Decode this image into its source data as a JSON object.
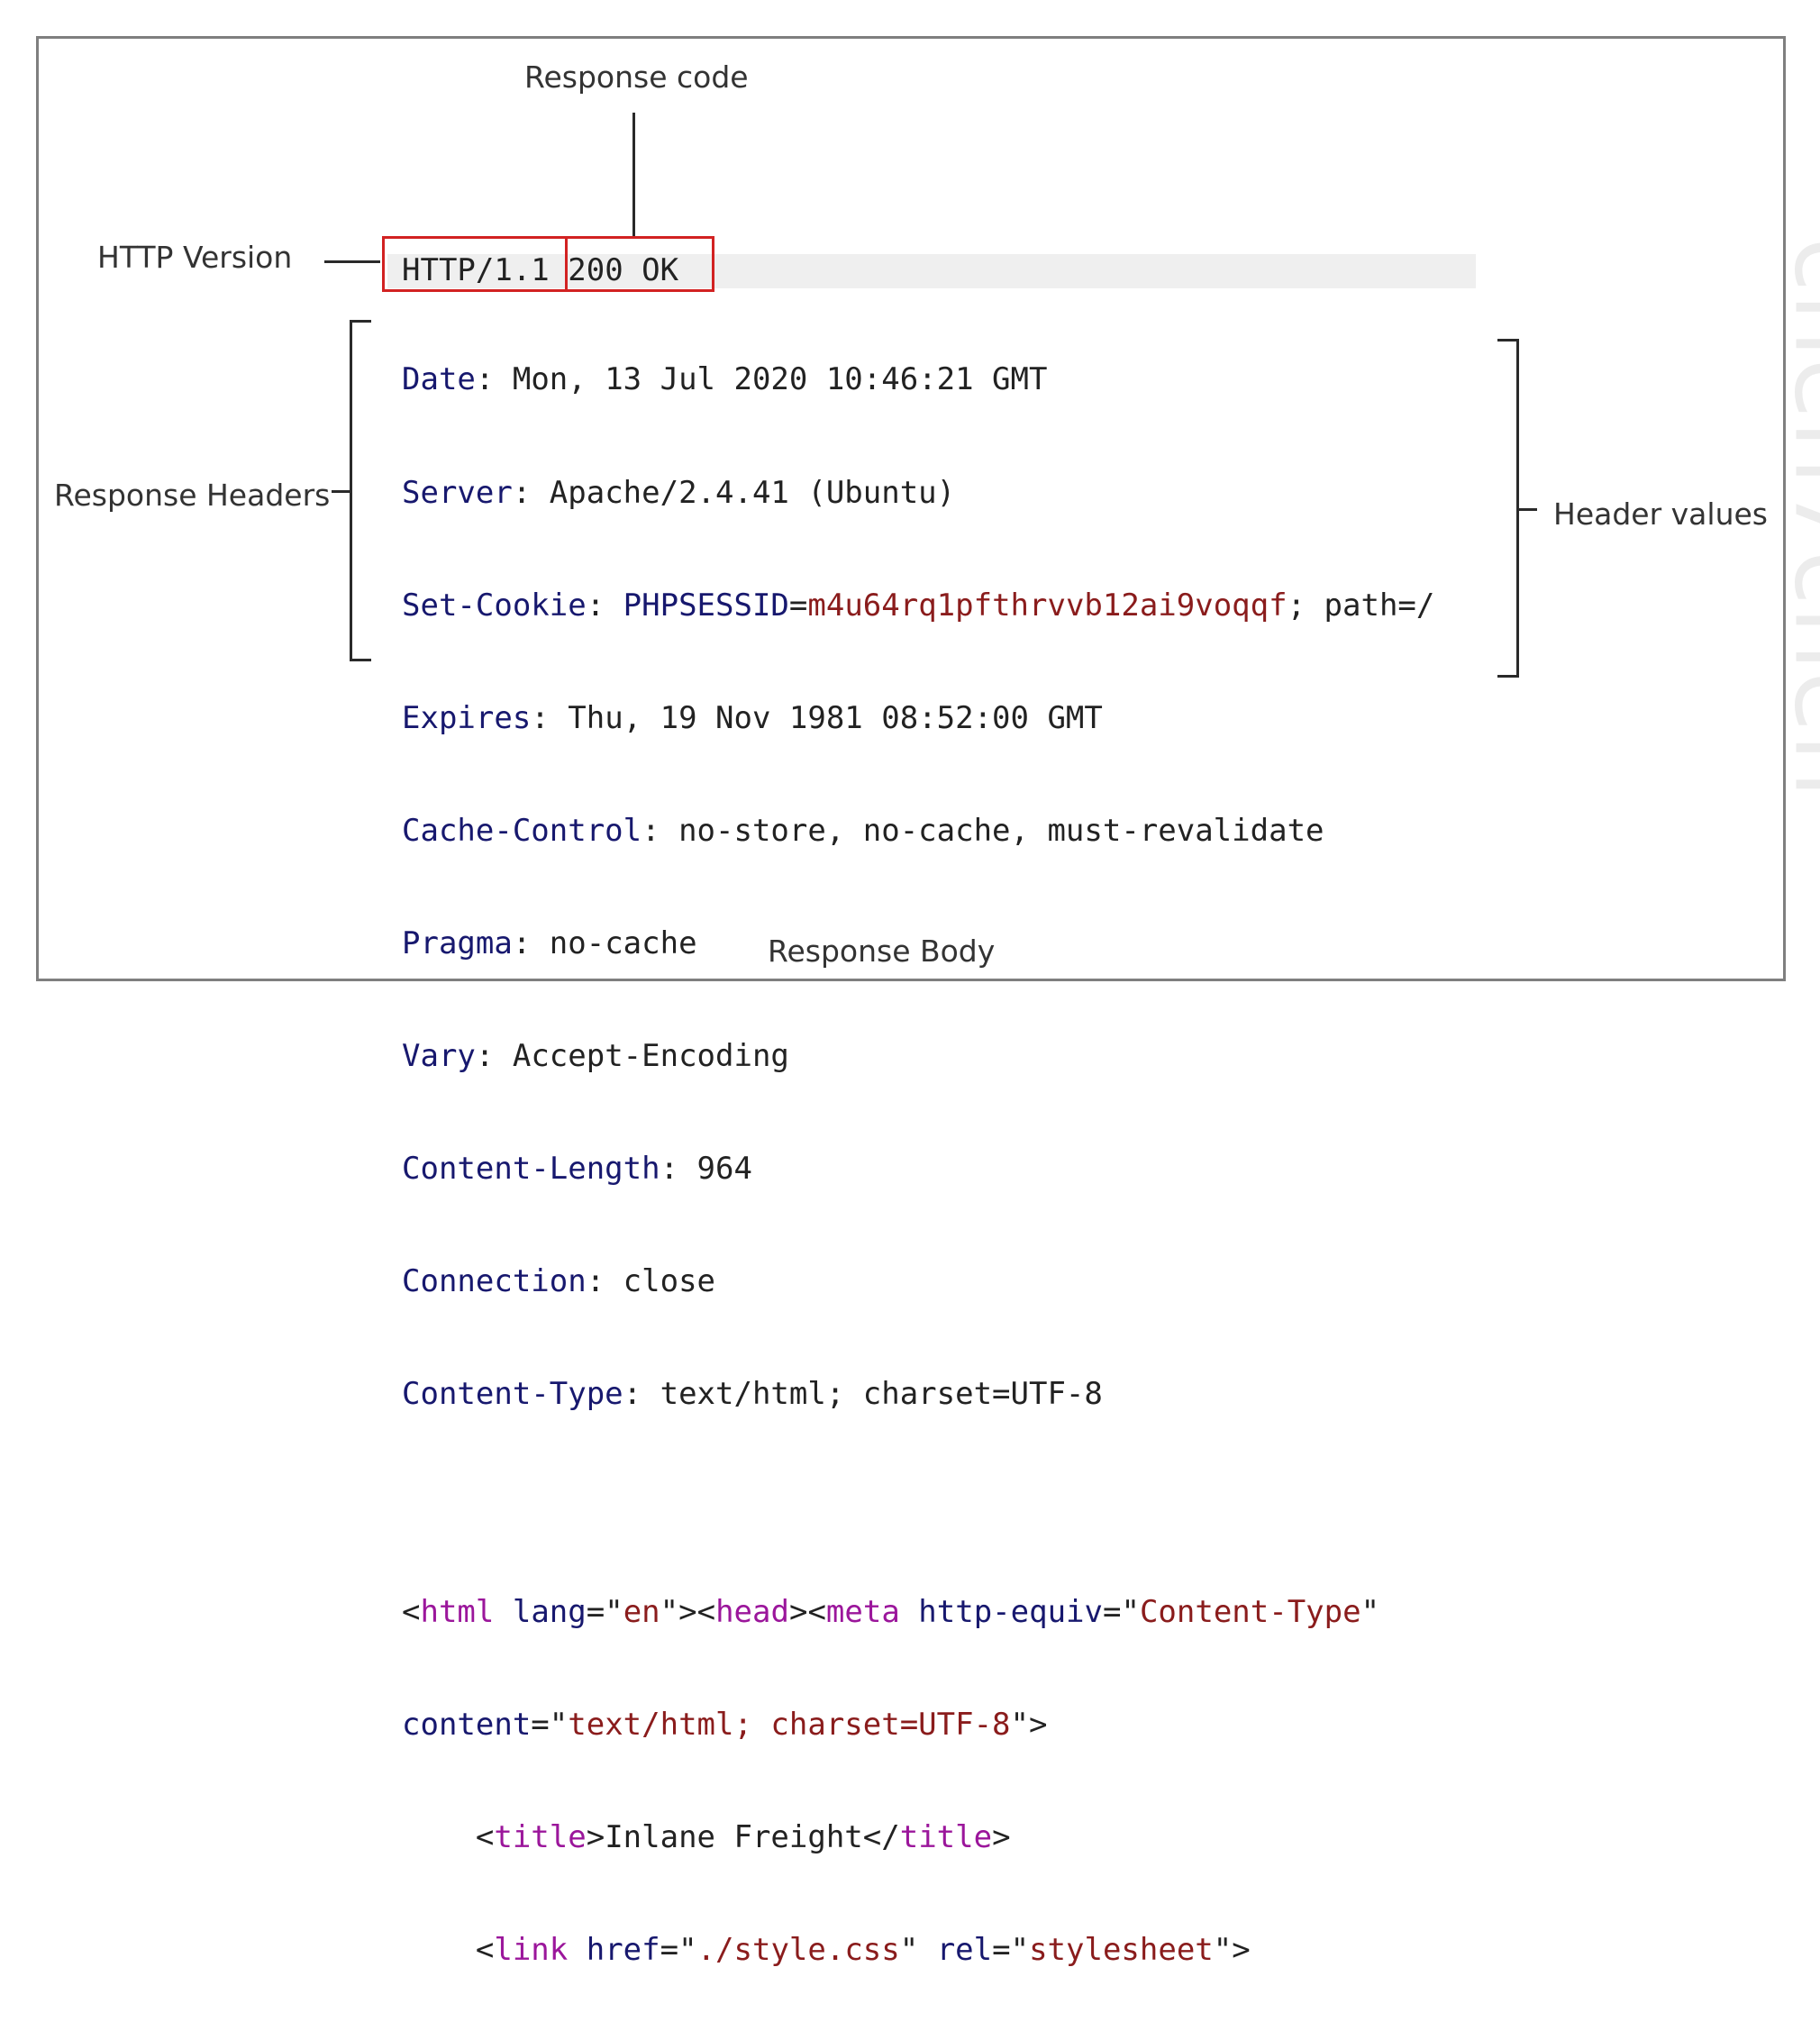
{
  "labels": {
    "response_code": "Response code",
    "http_version": "HTTP Version",
    "response_headers": "Response Headers",
    "header_values": "Header values",
    "response_body": "Response Body"
  },
  "status_line": {
    "version": "HTTP/1.1",
    "code": "200 OK"
  },
  "headers": [
    {
      "name": "Date",
      "value": "Mon, 13 Jul 2020 10:46:21 GMT"
    },
    {
      "name": "Server",
      "value": "Apache/2.4.41 (Ubuntu)"
    },
    {
      "name": "Set-Cookie",
      "cookie_name": "PHPSESSID",
      "cookie_value": "m4u64rq1pfthrvvb12ai9voqqf",
      "value": "path=/"
    },
    {
      "name": "Expires",
      "value": "Thu, 19 Nov 1981 08:52:00 GMT"
    },
    {
      "name": "Cache-Control",
      "value": "no-store, no-cache, must-revalidate"
    },
    {
      "name": "Pragma",
      "value": "no-cache"
    },
    {
      "name": "Vary",
      "value": "Accept-Encoding"
    },
    {
      "name": "Content-Length",
      "value": "964"
    },
    {
      "name": "Connection",
      "value": "close"
    },
    {
      "name": "Content-Type",
      "value": "text/html; charset=UTF-8"
    }
  ],
  "body": {
    "html_tag": "html",
    "lang_attr": "lang",
    "lang_val": "en",
    "head_tag": "head",
    "meta_tag": "meta",
    "http_equiv_attr": "http-equiv",
    "http_equiv_val": "Content-Type",
    "content_attr": "content",
    "content_val": "text/html; charset=UTF-8",
    "title_tag": "title",
    "title_text": "Inlane Freight",
    "link_tag": "link",
    "href_attr": "href",
    "href_val": "./style.css",
    "rel_attr": "rel",
    "rel_val": "stylesheet",
    "close_head_tag": "head"
  },
  "watermark": "chen7chen",
  "colors": {
    "highlight_box": "#d22222",
    "header_name": "#17186e",
    "cookie_value": "#8a1c1c",
    "html_tag": "#9b169b"
  }
}
